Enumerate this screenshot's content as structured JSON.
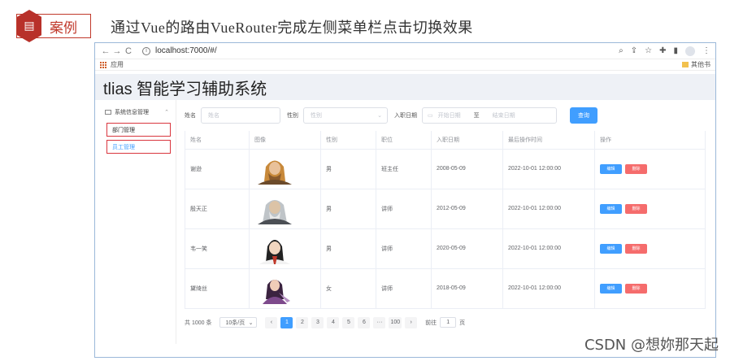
{
  "slide": {
    "badge_label": "案例",
    "title": "通过Vue的路由VueRouter完成左侧菜单栏点击切换效果"
  },
  "browser": {
    "url": "localhost:7000/#/",
    "bookmark_apps": "应用",
    "bookmark_other": "其他书"
  },
  "app": {
    "title": "tlias 智能学习辅助系统",
    "sidebar": {
      "group": "系统信息管理",
      "items": [
        {
          "label": "部门管理"
        },
        {
          "label": "员工管理"
        }
      ]
    },
    "search": {
      "name_label": "姓名",
      "name_placeholder": "姓名",
      "gender_label": "性别",
      "gender_placeholder": "性别",
      "date_label": "入职日期",
      "start_placeholder": "开始日期",
      "date_sep": "至",
      "end_placeholder": "结束日期",
      "query_button": "查询"
    },
    "table": {
      "headers": [
        "姓名",
        "图像",
        "性别",
        "职位",
        "入职日期",
        "最后操作时间",
        "操作"
      ],
      "rows": [
        {
          "name": "谢逊",
          "gender": "男",
          "job": "班主任",
          "entry": "2008-05-09",
          "updated": "2022-10-01 12:00:00",
          "avatar": "avatar-1"
        },
        {
          "name": "殷天正",
          "gender": "男",
          "job": "讲师",
          "entry": "2012-05-09",
          "updated": "2022-10-01 12:00:00",
          "avatar": "avatar-2"
        },
        {
          "name": "韦一笑",
          "gender": "男",
          "job": "讲师",
          "entry": "2020-05-09",
          "updated": "2022-10-01 12:00:00",
          "avatar": "avatar-3"
        },
        {
          "name": "黛绮丝",
          "gender": "女",
          "job": "讲师",
          "entry": "2018-05-09",
          "updated": "2022-10-01 12:00:00",
          "avatar": "avatar-4"
        }
      ],
      "edit_label": "编辑",
      "delete_label": "删除"
    },
    "pager": {
      "total": "共 1000 条",
      "page_size": "10条/页",
      "pages": [
        "1",
        "2",
        "3",
        "4",
        "5",
        "6",
        "···",
        "100"
      ],
      "current": "1",
      "goto_label": "前往",
      "goto_value": "1",
      "goto_suffix": "页"
    }
  },
  "watermark": "CSDN @想妳那天起"
}
